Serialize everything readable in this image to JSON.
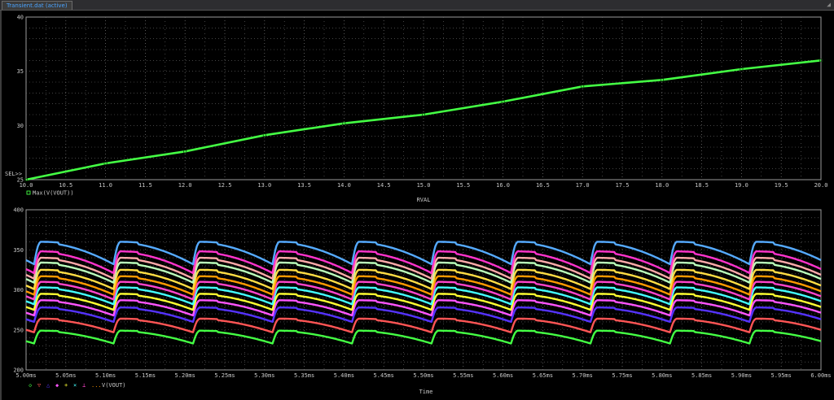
{
  "window": {
    "tab_title": "Transient.dat (active)",
    "corner_marker": "◢"
  },
  "colors": {
    "background": "#000000",
    "grid": "#6e6e6e",
    "axis_text": "#c8c8c8",
    "series": [
      "#44ff44",
      "#ff5555",
      "#5533ff",
      "#ff55ff",
      "#ffff33",
      "#44ffff",
      "#ff44cc",
      "#ff9900",
      "#ffdd44",
      "#bbffbb",
      "#ffaaaa",
      "#ff33cc",
      "#55aaff"
    ]
  },
  "chart_data": [
    {
      "type": "line",
      "title": "",
      "xlabel": "RVAL",
      "ylabel": "",
      "xlim": [
        10.0,
        20.0
      ],
      "ylim": [
        25,
        40
      ],
      "xticks": [
        "10.0",
        "10.5",
        "11.0",
        "11.5",
        "12.0",
        "12.5",
        "13.0",
        "13.5",
        "14.0",
        "14.5",
        "15.0",
        "15.5",
        "16.0",
        "16.5",
        "17.0",
        "17.5",
        "18.0",
        "18.5",
        "19.0",
        "19.5",
        "20.0"
      ],
      "yticks": [
        "25",
        "30",
        "35",
        "40"
      ],
      "grid": true,
      "cursor_label": "SEL>>",
      "legend": [
        "Max(V(VOUT))"
      ],
      "series": [
        {
          "name": "Max(V(VOUT))",
          "x": [
            10.0,
            11.0,
            12.0,
            13.0,
            14.0,
            15.0,
            16.0,
            17.0,
            18.0,
            19.0,
            20.0
          ],
          "y": [
            25.0,
            26.5,
            27.6,
            29.1,
            30.2,
            31.0,
            32.2,
            33.6,
            34.2,
            35.2,
            36.0
          ]
        }
      ]
    },
    {
      "type": "line",
      "title": "",
      "xlabel": "Time",
      "ylabel": "",
      "xlim": [
        5.0,
        6.0
      ],
      "ylim": [
        200,
        400
      ],
      "xticks": [
        "5.00ms",
        "5.05ms",
        "5.10ms",
        "5.15ms",
        "5.20ms",
        "5.25ms",
        "5.30ms",
        "5.35ms",
        "5.40ms",
        "5.45ms",
        "5.50ms",
        "5.55ms",
        "5.60ms",
        "5.65ms",
        "5.70ms",
        "5.75ms",
        "5.80ms",
        "5.85ms",
        "5.90ms",
        "5.95ms",
        "6.00ms"
      ],
      "yticks": [
        "200",
        "250",
        "300",
        "350",
        "400"
      ],
      "grid": true,
      "legend": [
        "V(VOUT)"
      ],
      "legend_symbols": [
        "◇",
        "▽",
        "△",
        "◆",
        "+",
        "×",
        "⊥",
        "...",
        "V(VOUT)"
      ],
      "waveform": {
        "period_ms": 0.1,
        "first_trough_ms": 5.01,
        "ripple": [
          16,
          17,
          18,
          19,
          20,
          21,
          22,
          23,
          24,
          25,
          26,
          27,
          28
        ]
      },
      "series": [
        {
          "name": "",
          "peak": 249
        },
        {
          "name": "",
          "peak": 264
        },
        {
          "name": "",
          "peak": 278
        },
        {
          "name": "",
          "peak": 287
        },
        {
          "name": "",
          "peak": 295
        },
        {
          "name": "",
          "peak": 303
        },
        {
          "name": "",
          "peak": 310
        },
        {
          "name": "",
          "peak": 317
        },
        {
          "name": "",
          "peak": 325
        },
        {
          "name": "",
          "peak": 334
        },
        {
          "name": "",
          "peak": 340
        },
        {
          "name": "",
          "peak": 348
        },
        {
          "name": "",
          "peak": 360
        }
      ]
    }
  ]
}
